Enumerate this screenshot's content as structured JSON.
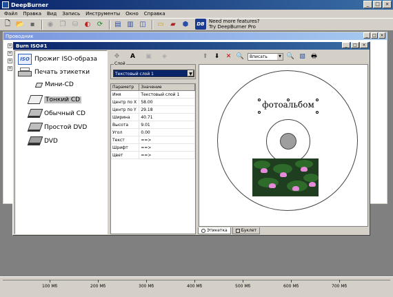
{
  "app": {
    "title": "DeepBurner"
  },
  "menu": [
    "Файл",
    "Правка",
    "Вид",
    "Запись",
    "Инструменты",
    "Окно",
    "Справка"
  ],
  "promo": {
    "logo": "DB",
    "line1": "Need more features?",
    "line2": "Try DeepBurner Pro"
  },
  "explorer": {
    "title": "Проводник"
  },
  "burn_window": {
    "title": "Burn ISO#1"
  },
  "tree": {
    "items": [
      {
        "label": "Прожиг ISO-образа",
        "icon": "iso-icon"
      },
      {
        "label": "Печать этикетки",
        "icon": "printer-icon"
      },
      {
        "label": "Мини-CD",
        "icon": "mini-cd-icon"
      },
      {
        "label": "Тонкий CD",
        "icon": "thin-cd-icon"
      },
      {
        "label": "Обычный CD",
        "icon": "regular-cd-icon"
      },
      {
        "label": "Простой DVD",
        "icon": "simple-dvd-icon"
      },
      {
        "label": "DVD",
        "icon": "dvd-icon"
      }
    ]
  },
  "layer": {
    "group_label": "Слой",
    "selected": "Текстовый слой 1"
  },
  "props": {
    "headers": [
      "Параметр",
      "Значение"
    ],
    "rows": [
      [
        "Имя",
        "Текстовый слой 1"
      ],
      [
        "Центр по X",
        "58.00"
      ],
      [
        "Центр по Y",
        "29.18"
      ],
      [
        "Ширина",
        "40.71"
      ],
      [
        "Высота",
        "9.01"
      ],
      [
        "Угол",
        "0.00"
      ],
      [
        "Текст",
        "==>"
      ],
      [
        "Шрифт",
        "==>"
      ],
      [
        "Цвет",
        "==>"
      ]
    ]
  },
  "zoom": {
    "value": "Вписать"
  },
  "label_text": "фотоальбом",
  "tabs": {
    "label": "Этикетка",
    "booklet": "Буклет"
  },
  "ruler": [
    "100 Мб",
    "200 Мб",
    "300 Мб",
    "400 Мб",
    "500 Мб",
    "600 Мб",
    "700 Мб"
  ]
}
